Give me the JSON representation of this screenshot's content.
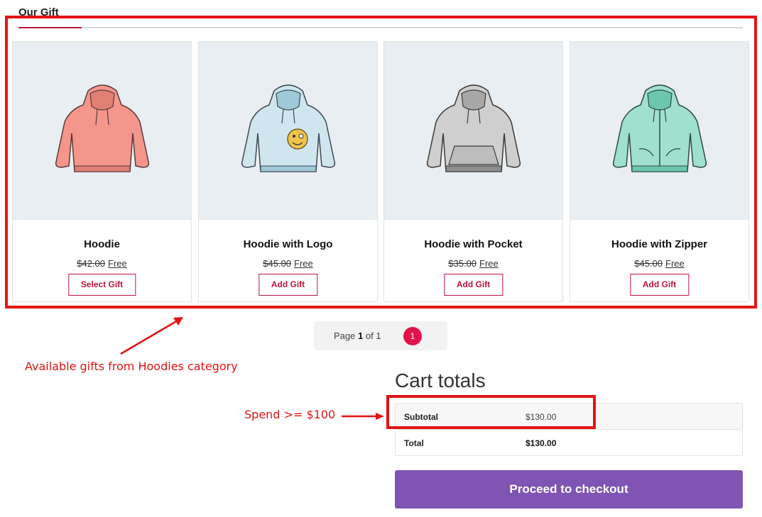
{
  "gifts_section": {
    "title": "Our Gift"
  },
  "products": [
    {
      "name": "Hoodie",
      "old_price": "$42.00",
      "new_price": "Free",
      "button": "Select Gift",
      "color": "#f4968c",
      "shade": "#e07f74",
      "icon": "hoodie-icon"
    },
    {
      "name": "Hoodie with Logo",
      "old_price": "$45.00",
      "new_price": "Free",
      "button": "Add Gift",
      "color": "#cfe6ef",
      "shade": "#9fc8d8",
      "icon": "hoodie-logo-icon"
    },
    {
      "name": "Hoodie with Pocket",
      "old_price": "$35.00",
      "new_price": "Free",
      "button": "Add Gift",
      "color": "#cfcfcf",
      "shade": "#a7a7a7",
      "icon": "hoodie-pocket-icon"
    },
    {
      "name": "Hoodie with Zipper",
      "old_price": "$45.00",
      "new_price": "Free",
      "button": "Add Gift",
      "color": "#9fe0cf",
      "shade": "#6cc6b0",
      "icon": "hoodie-zipper-icon"
    }
  ],
  "pagination": {
    "prefix": "Page",
    "current": "1",
    "separator": "of",
    "total": "1",
    "dot": "1"
  },
  "cart_totals": {
    "title": "Cart totals",
    "subtotal_label": "Subtotal",
    "subtotal_value": "$130.00",
    "total_label": "Total",
    "total_value": "$130.00",
    "checkout_label": "Proceed to checkout"
  },
  "annotations": {
    "gifts_note": "Available gifts from Hoodies category",
    "spend_note": "Spend >= $100",
    "color": "#e31313"
  },
  "colors": {
    "accent": "#c0143c",
    "pagination_dot": "#e2124a",
    "checkout": "#7f54b3",
    "image_bg": "#e9eef2"
  }
}
